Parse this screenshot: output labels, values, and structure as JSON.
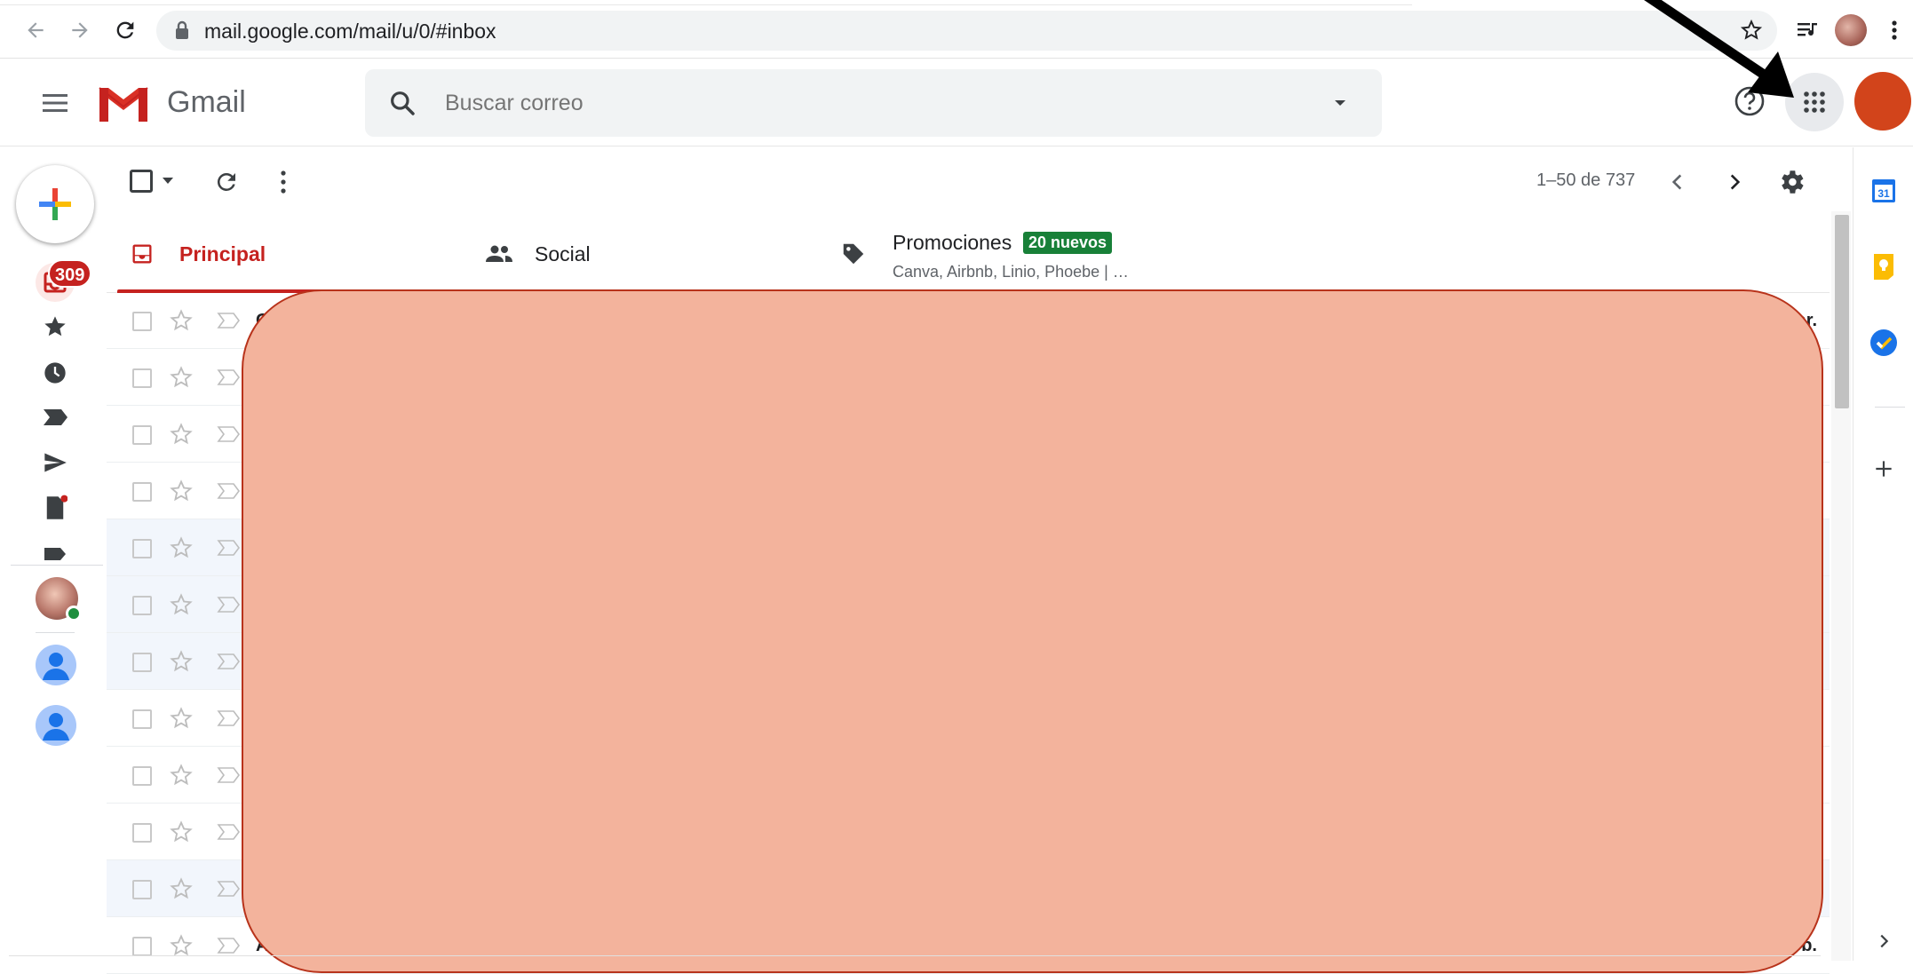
{
  "browser": {
    "url": "mail.google.com/mail/u/0/#inbox"
  },
  "app": {
    "name": "Gmail",
    "brand_color": "#c5221f"
  },
  "search": {
    "placeholder": "Buscar correo"
  },
  "rail": {
    "inbox_unread_count": "309"
  },
  "toolbar": {
    "page_range": "1–50 de 737"
  },
  "tabs": [
    {
      "label": "Principal",
      "selected": true,
      "icon": "inbox-icon"
    },
    {
      "label": "Social",
      "selected": false,
      "icon": "people-icon"
    },
    {
      "label": "Promociones",
      "selected": false,
      "icon": "tag-icon",
      "badge": "20 nuevos",
      "snippet": "Canva, Airbnb, Linio, Phoebe | …"
    }
  ],
  "emails": [
    {
      "sender": "Go",
      "date": "ar.",
      "read": false
    },
    {
      "sender": "",
      "date": "",
      "read": false
    },
    {
      "sender": "",
      "date": "",
      "read": false
    },
    {
      "sender": "",
      "date": "",
      "read": false
    },
    {
      "sender": "",
      "date": "",
      "read": true
    },
    {
      "sender": "",
      "date": "",
      "read": true
    },
    {
      "sender": "",
      "date": "",
      "read": true
    },
    {
      "sender": "",
      "date": "",
      "read": false
    },
    {
      "sender": "",
      "date": "",
      "read": false
    },
    {
      "sender": "",
      "date": "",
      "read": false
    },
    {
      "sender": "",
      "date": "",
      "read": true
    },
    {
      "sender": "Airb",
      "date": "eb.",
      "read": false
    }
  ],
  "side_panel": {
    "calendar_day": "31"
  }
}
